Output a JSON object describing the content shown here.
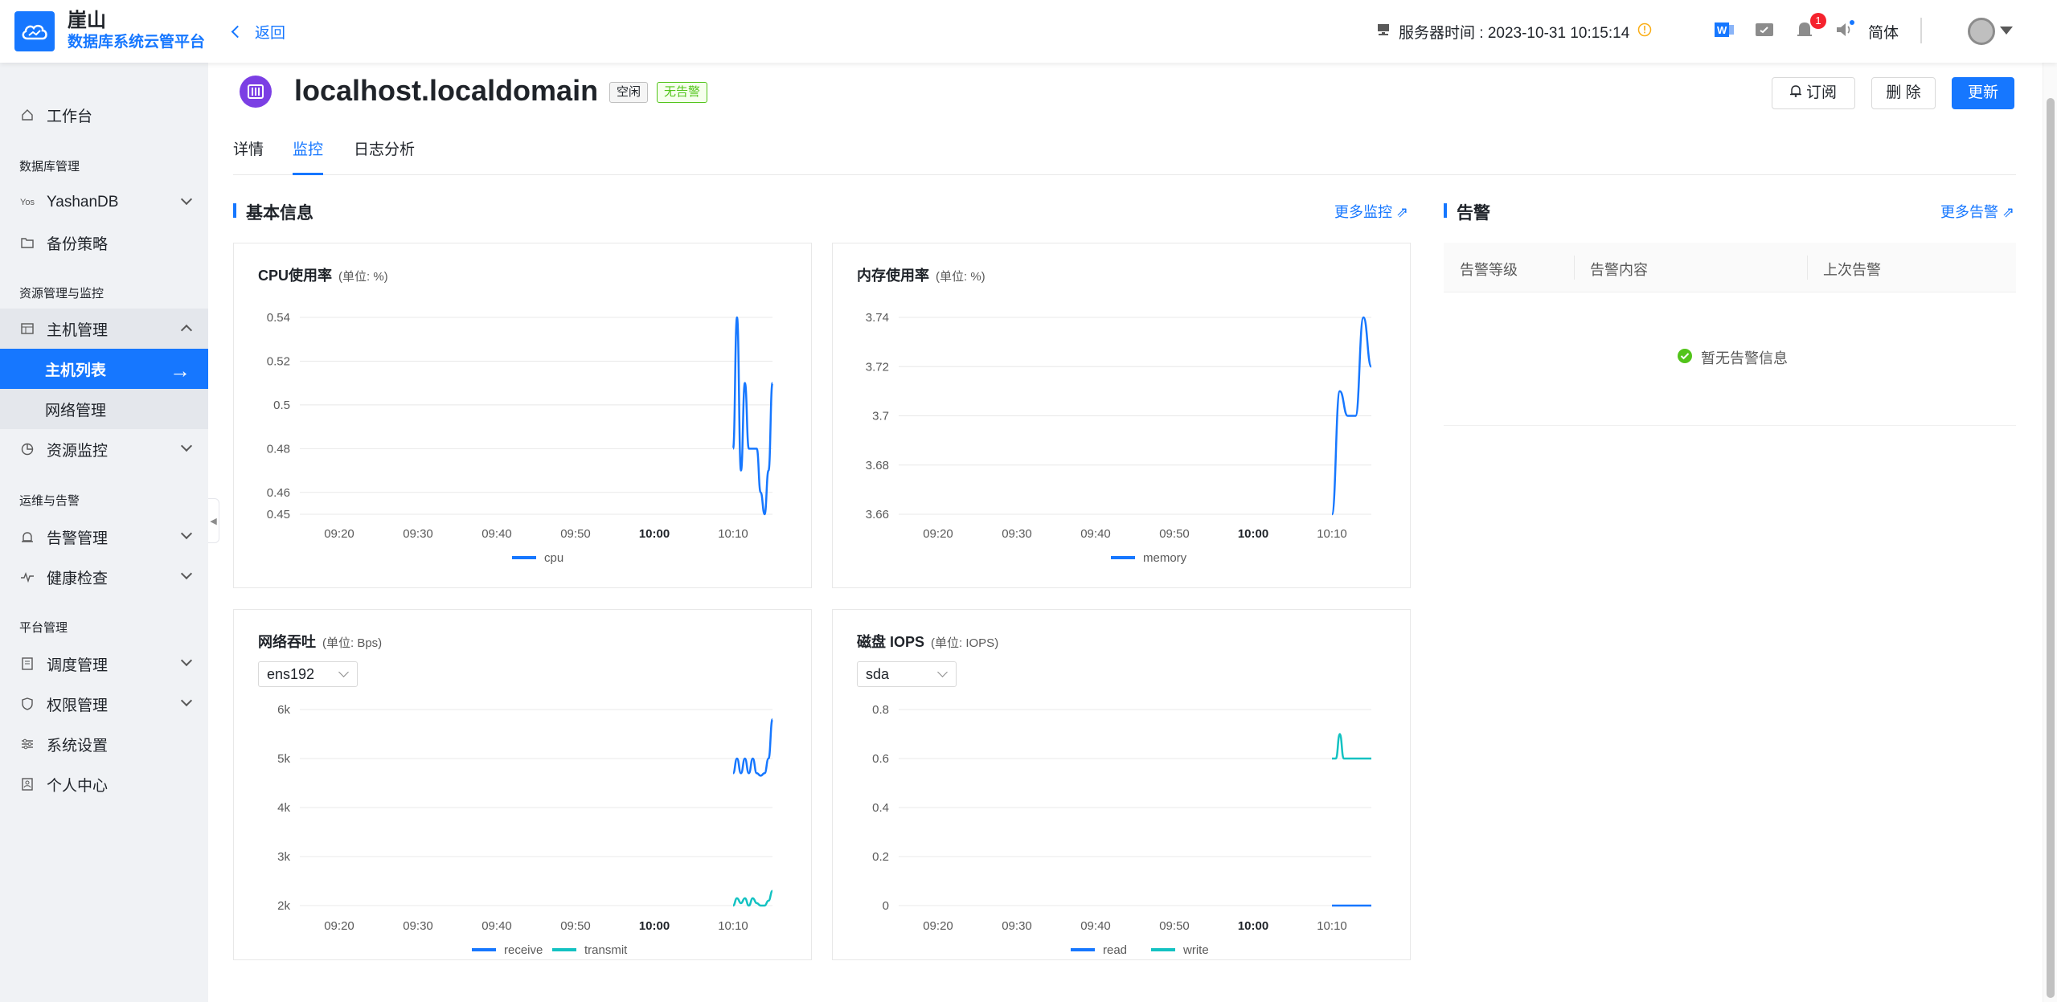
{
  "header": {
    "brand_name": "崖山",
    "brand_sub": "数据库系统云管平台",
    "back_label": "返回",
    "server_time": "服务器时间 : 2023-10-31 10:15:14",
    "notif_count": "1",
    "lang": "简体"
  },
  "sidebar": {
    "workbench": "工作台",
    "group_db": "数据库管理",
    "yashandb": "YashanDB",
    "yashandb_prefix": "Yos",
    "backup": "备份策略",
    "group_res": "资源管理与监控",
    "host_mgmt": "主机管理",
    "host_list": "主机列表",
    "network_mgmt": "网络管理",
    "res_monitor": "资源监控",
    "group_ops": "运维与告警",
    "alarm_mgmt": "告警管理",
    "health_check": "健康检查",
    "group_platform": "平台管理",
    "schedule_mgmt": "调度管理",
    "perm_mgmt": "权限管理",
    "sys_settings": "系统设置",
    "personal": "个人中心"
  },
  "page": {
    "host_title": "localhost.localdomain",
    "tag_idle": "空闲",
    "tag_no_alarm": "无告警",
    "btn_subscribe": "订阅",
    "btn_delete": "删 除",
    "btn_update": "更新",
    "tabs": [
      "详情",
      "监控",
      "日志分析"
    ],
    "basic_info": "基本信息",
    "more_monitor": "更多监控",
    "alarm_title": "告警",
    "more_alarm": "更多告警",
    "alarm_cols": [
      "告警等级",
      "告警内容",
      "上次告警"
    ],
    "alarm_empty": "暂无告警信息"
  },
  "chart_data": [
    {
      "type": "line",
      "title": "CPU使用率",
      "unit": "(单位: %)",
      "x_ticks": [
        "09:20",
        "09:30",
        "09:40",
        "09:50",
        "10:00",
        "10:10"
      ],
      "y_ticks": [
        "0.54",
        "0.52",
        "0.5",
        "0.48",
        "0.46",
        "0.45"
      ],
      "ylim": [
        0.45,
        0.54
      ],
      "series": [
        {
          "name": "cpu",
          "color": "#1677ff",
          "x": [
            "10:10",
            "10:10:30",
            "10:11",
            "10:11:30",
            "10:12",
            "10:12:30",
            "10:13",
            "10:13:30",
            "10:14",
            "10:14:30",
            "10:15"
          ],
          "values": [
            0.48,
            0.54,
            0.47,
            0.51,
            0.48,
            0.48,
            0.48,
            0.46,
            0.45,
            0.47,
            0.51
          ]
        }
      ]
    },
    {
      "type": "line",
      "title": "内存使用率",
      "unit": "(单位: %)",
      "x_ticks": [
        "09:20",
        "09:30",
        "09:40",
        "09:50",
        "10:00",
        "10:10"
      ],
      "y_ticks": [
        "3.74",
        "3.72",
        "3.7",
        "3.68",
        "3.66"
      ],
      "ylim": [
        3.66,
        3.74
      ],
      "series": [
        {
          "name": "memory",
          "color": "#1677ff",
          "x": [
            "10:10",
            "10:11",
            "10:12",
            "10:13",
            "10:14",
            "10:15"
          ],
          "values": [
            3.66,
            3.71,
            3.7,
            3.7,
            3.74,
            3.72
          ]
        }
      ]
    },
    {
      "type": "line",
      "title": "网络吞吐",
      "unit": "(单位: Bps)",
      "select": "ens192",
      "x_ticks": [
        "09:20",
        "09:30",
        "09:40",
        "09:50",
        "10:00",
        "10:10"
      ],
      "y_ticks": [
        "6k",
        "5k",
        "4k",
        "3k",
        "2k"
      ],
      "ylim": [
        2000,
        6000
      ],
      "series": [
        {
          "name": "receive",
          "color": "#1677ff",
          "x": [
            "10:10",
            "10:10:30",
            "10:11",
            "10:11:30",
            "10:12",
            "10:12:30",
            "10:13",
            "10:13:30",
            "10:14",
            "10:14:30",
            "10:15"
          ],
          "values": [
            4700,
            5000,
            4700,
            5000,
            4700,
            5000,
            4700,
            4650,
            4700,
            5000,
            5800
          ]
        },
        {
          "name": "transmit",
          "color": "#13c2c2",
          "x": [
            "10:10",
            "10:10:30",
            "10:11",
            "10:11:30",
            "10:12",
            "10:12:30",
            "10:13",
            "10:13:30",
            "10:14",
            "10:14:30",
            "10:15"
          ],
          "values": [
            2000,
            2150,
            2050,
            2150,
            2000,
            2150,
            2050,
            2000,
            2000,
            2100,
            2300
          ]
        }
      ]
    },
    {
      "type": "line",
      "title": "磁盘 IOPS",
      "unit": "(单位: IOPS)",
      "select": "sda",
      "x_ticks": [
        "09:20",
        "09:30",
        "09:40",
        "09:50",
        "10:00",
        "10:10"
      ],
      "y_ticks": [
        "0.8",
        "0.6",
        "0.4",
        "0.2",
        "0"
      ],
      "ylim": [
        0,
        0.8
      ],
      "series": [
        {
          "name": "read",
          "color": "#1677ff",
          "x": [
            "10:10",
            "10:11",
            "10:12",
            "10:13",
            "10:14",
            "10:15"
          ],
          "values": [
            0,
            0,
            0,
            0,
            0,
            0
          ]
        },
        {
          "name": "write",
          "color": "#13c2c2",
          "x": [
            "10:10",
            "10:10:30",
            "10:11",
            "10:11:30",
            "10:12",
            "10:12:30",
            "10:13",
            "10:14",
            "10:15"
          ],
          "values": [
            0.6,
            0.6,
            0.7,
            0.6,
            0.6,
            0.6,
            0.6,
            0.6,
            0.6
          ]
        }
      ]
    }
  ]
}
